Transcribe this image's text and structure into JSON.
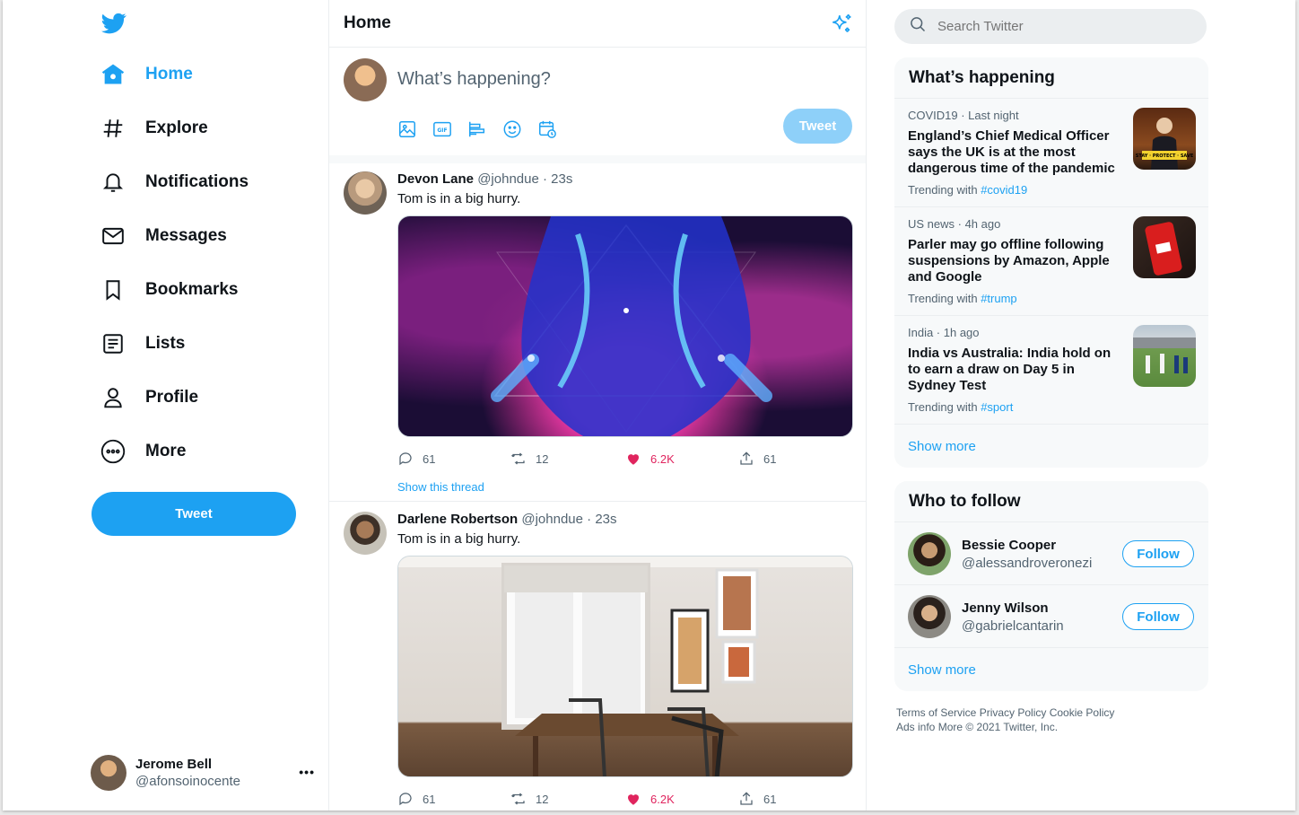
{
  "nav": {
    "items": [
      {
        "label": "Home",
        "icon": "home-icon"
      },
      {
        "label": "Explore",
        "icon": "hash-icon"
      },
      {
        "label": "Notifications",
        "icon": "bell-icon"
      },
      {
        "label": "Messages",
        "icon": "mail-icon"
      },
      {
        "label": "Bookmarks",
        "icon": "bookmark-icon"
      },
      {
        "label": "Lists",
        "icon": "list-icon"
      },
      {
        "label": "Profile",
        "icon": "person-icon"
      },
      {
        "label": "More",
        "icon": "more-circle-icon"
      }
    ],
    "tweet_label": "Tweet"
  },
  "current_user": {
    "name": "Jerome Bell",
    "handle": "@afonsoinocente",
    "menu": "•••"
  },
  "header": {
    "title": "Home"
  },
  "composer": {
    "placeholder": "What’s happening?",
    "tweet_label": "Tweet",
    "tools": [
      "image-icon",
      "gif-icon",
      "poll-icon",
      "emoji-icon",
      "schedule-icon"
    ]
  },
  "tweets": [
    {
      "name": "Devon Lane",
      "handle": "@johndue",
      "sep": "·",
      "time": "23s",
      "text": "Tom is in a big hurry.",
      "replies": "61",
      "retweets": "12",
      "likes": "6.2K",
      "shares": "61",
      "thread": "Show this thread"
    },
    {
      "name": "Darlene Robertson",
      "handle": "@johndue",
      "sep": "·",
      "time": "23s",
      "text": "Tom is in a big hurry.",
      "replies": "61",
      "retweets": "12",
      "likes": "6.2K",
      "shares": "61"
    }
  ],
  "search": {
    "placeholder": "Search Twitter"
  },
  "whats_happening": {
    "title": "What’s happening",
    "trends": [
      {
        "context": "COVID19 · Last night",
        "headline": "England’s Chief Medical Officer says the UK is at the most dangerous time of the pandemic",
        "trending_prefix": "Trending with",
        "tag": "#covid19"
      },
      {
        "context": "US news · 4h ago",
        "headline": "Parler may go offline following suspensions by Amazon, Apple and Google",
        "trending_prefix": "Trending with",
        "tag": "#trump"
      },
      {
        "context": "India · 1h ago",
        "headline": "India vs Australia: India hold on to earn a draw on Day 5 in Sydney Test",
        "trending_prefix": "Trending with",
        "tag": "#sport"
      }
    ],
    "show_more": "Show more"
  },
  "who_to_follow": {
    "title": "Who to follow",
    "users": [
      {
        "name": "Bessie Cooper",
        "handle": "@alessandroveronezi",
        "button": "Follow"
      },
      {
        "name": "Jenny Wilson",
        "handle": "@gabrielcantarin",
        "button": "Follow"
      }
    ],
    "show_more": "Show more"
  },
  "footer": {
    "line1": "Terms of Service Privacy Policy Cookie Policy",
    "line2": "Ads info More © 2021 Twitter, Inc."
  },
  "colors": {
    "accent": "#1da1f2",
    "like": "#e0245e",
    "muted": "#536471"
  }
}
